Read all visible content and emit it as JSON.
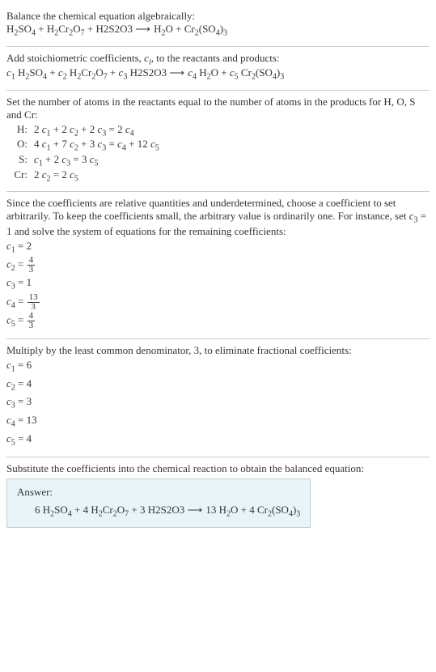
{
  "section1": {
    "text": "Balance the chemical equation algebraically:",
    "eq": "H₂SO₄ + H₂Cr₂O₇ + H2S2O3 ⟶ H₂O + Cr₂(SO₄)₃"
  },
  "section2": {
    "text_a": "Add stoichiometric coefficients, ",
    "c": "c",
    "ci": "i",
    "text_b": ", to the reactants and products:",
    "eq": "c₁ H₂SO₄ + c₂ H₂Cr₂O₇ + c₃ H2S2O3 ⟶ c₄ H₂O + c₅ Cr₂(SO₄)₃"
  },
  "section3": {
    "text": "Set the number of atoms in the reactants equal to the number of atoms in the products for H, O, S and Cr:",
    "rows": [
      {
        "el": "H:",
        "eq": "2 c₁ + 2 c₂ + 2 c₃ = 2 c₄"
      },
      {
        "el": "O:",
        "eq": "4 c₁ + 7 c₂ + 3 c₃ = c₄ + 12 c₅"
      },
      {
        "el": "S:",
        "eq": "c₁ + 2 c₃ = 3 c₅"
      },
      {
        "el": "Cr:",
        "eq": "2 c₂ = 2 c₅"
      }
    ]
  },
  "section4": {
    "text": "Since the coefficients are relative quantities and underdetermined, choose a coefficient to set arbitrarily. To keep the coefficients small, the arbitrary value is ordinarily one. For instance, set c₃ = 1 and solve the system of equations for the remaining coefficients:",
    "c1": "c₁ = 2",
    "c2_pre": "c₂ = ",
    "c2_num": "4",
    "c2_den": "3",
    "c3": "c₃ = 1",
    "c4_pre": "c₄ = ",
    "c4_num": "13",
    "c4_den": "3",
    "c5_pre": "c₅ = ",
    "c5_num": "4",
    "c5_den": "3"
  },
  "section5": {
    "text": "Multiply by the least common denominator, 3, to eliminate fractional coefficients:",
    "lines": [
      "c₁ = 6",
      "c₂ = 4",
      "c₃ = 3",
      "c₄ = 13",
      "c₅ = 4"
    ]
  },
  "section6": {
    "text": "Substitute the coefficients into the chemical reaction to obtain the balanced equation:",
    "answer_hdr": "Answer:",
    "answer_eq": "6 H₂SO₄ + 4 H₂Cr₂O₇ + 3 H2S2O3 ⟶ 13 H₂O + 4 Cr₂(SO₄)₃"
  }
}
